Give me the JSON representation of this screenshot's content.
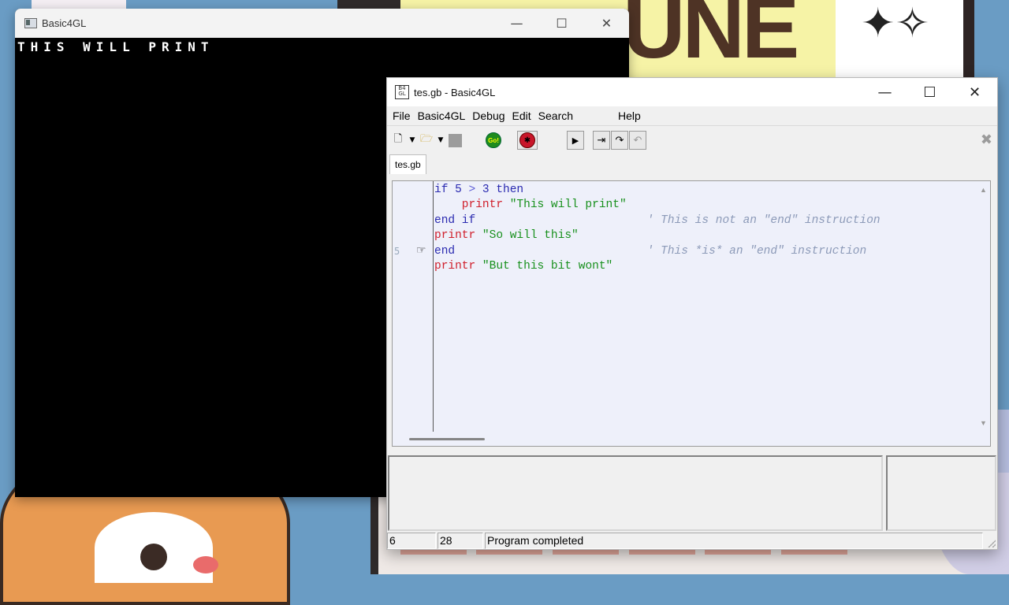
{
  "console": {
    "title": "Basic4GL",
    "output": "THIS WILL PRINT",
    "controls": {
      "minimize": "—",
      "maximize": "☐",
      "close": "✕"
    }
  },
  "editor": {
    "title": "tes.gb - Basic4GL",
    "controls": {
      "minimize": "—",
      "maximize": "☐",
      "close": "✕"
    },
    "menu": [
      "File",
      "Basic4GL",
      "Debug",
      "Edit",
      "Search",
      "Help"
    ],
    "toolbar": {
      "new_icon": "new-document-icon",
      "open_icon": "open-folder-icon",
      "stop_icon": "stop-icon",
      "go_label": "Go!",
      "debug_icon": "debug-bug-icon",
      "play_icon": "play-icon",
      "step_into_icon": "step-into-icon",
      "step_over_icon": "step-over-icon",
      "step_out_icon": "step-out-icon",
      "close_tab_icon": "close-tab-icon"
    },
    "tab": "tes.gb",
    "line_number_shown": "5",
    "code": [
      [
        {
          "t": "if ",
          "c": "kw"
        },
        {
          "t": "5",
          "c": "kw"
        },
        {
          "t": " > ",
          "c": "op"
        },
        {
          "t": "3 then",
          "c": "kw"
        }
      ],
      [
        {
          "t": "    printr ",
          "c": "fn"
        },
        {
          "t": "\"This will print\"",
          "c": "st"
        }
      ],
      [
        {
          "t": "end if",
          "c": "kw"
        },
        {
          "t": "                         ",
          "c": ""
        },
        {
          "t": "' This is not an \"end\" instruction",
          "c": "cm"
        }
      ],
      [
        {
          "t": "printr ",
          "c": "fn"
        },
        {
          "t": "\"So will this\"",
          "c": "st"
        }
      ],
      [
        {
          "t": "end",
          "c": "kw"
        },
        {
          "t": "                            ",
          "c": ""
        },
        {
          "t": "' This *is* an \"end\" instruction",
          "c": "cm"
        }
      ],
      [
        {
          "t": "printr ",
          "c": "fn"
        },
        {
          "t": "\"But this bit wont\"",
          "c": "st"
        }
      ]
    ],
    "status": {
      "line": "6",
      "col": "28",
      "message": "Program completed"
    }
  },
  "colors": {
    "keyword": "#2a2ab0",
    "function": "#d0202c",
    "string": "#18901d",
    "comment": "#8c9ab8"
  }
}
